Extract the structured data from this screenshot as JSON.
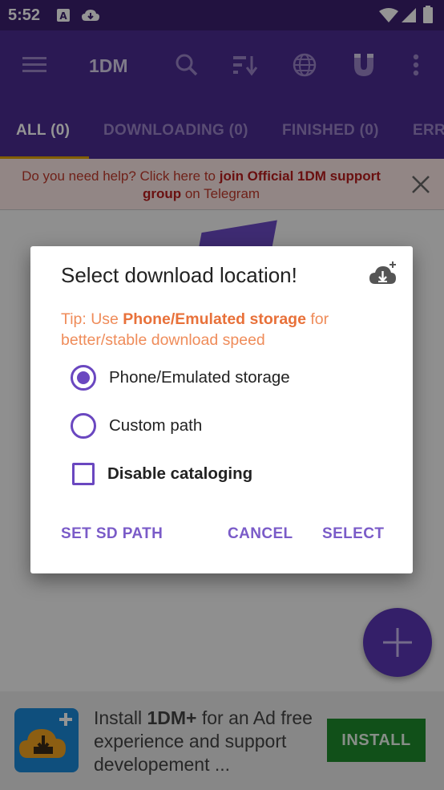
{
  "status_bar": {
    "time": "5:52",
    "icons": [
      "notification-a-icon",
      "download-cloud-icon",
      "wifi-icon",
      "signal-icon",
      "battery-icon"
    ]
  },
  "app_bar": {
    "title": "1DM",
    "icons": [
      "menu-icon",
      "search-icon",
      "sort-icon",
      "globe-icon",
      "magnet-icon",
      "more-vert-icon"
    ]
  },
  "tabs": [
    {
      "label": "ALL (0)",
      "active": true
    },
    {
      "label": "DOWNLOADING (0)",
      "active": false
    },
    {
      "label": "FINISHED (0)",
      "active": false
    },
    {
      "label": "ERR",
      "active": false
    }
  ],
  "banner": {
    "text_1": "Do you need help? Click here to ",
    "link_text": "join Official 1DM support group",
    "text_2": " on Telegram"
  },
  "dialog": {
    "title": "Select download location!",
    "tip_prefix": "Tip: Use ",
    "tip_highlight": "Phone/Emulated storage",
    "tip_suffix": " for better/stable download speed",
    "options": [
      {
        "label": "Phone/Emulated storage",
        "type": "radio",
        "selected": true
      },
      {
        "label": "Custom path",
        "type": "radio",
        "selected": false
      },
      {
        "label": "Disable cataloging",
        "type": "checkbox",
        "checked": false
      }
    ],
    "buttons": {
      "set_sd_path": "SET SD PATH",
      "cancel": "CANCEL",
      "select": "SELECT"
    }
  },
  "ad": {
    "text_1": "Install ",
    "text_bold": "1DM+",
    "text_2": " for an Ad free experience and support developement ...",
    "install_label": "INSTALL"
  },
  "colors": {
    "primary": "#4a2b91",
    "accent": "#6a47c0",
    "tab_indicator": "#e0a200",
    "tip": "#ef8c5a",
    "install_button": "#1e8a2c"
  }
}
